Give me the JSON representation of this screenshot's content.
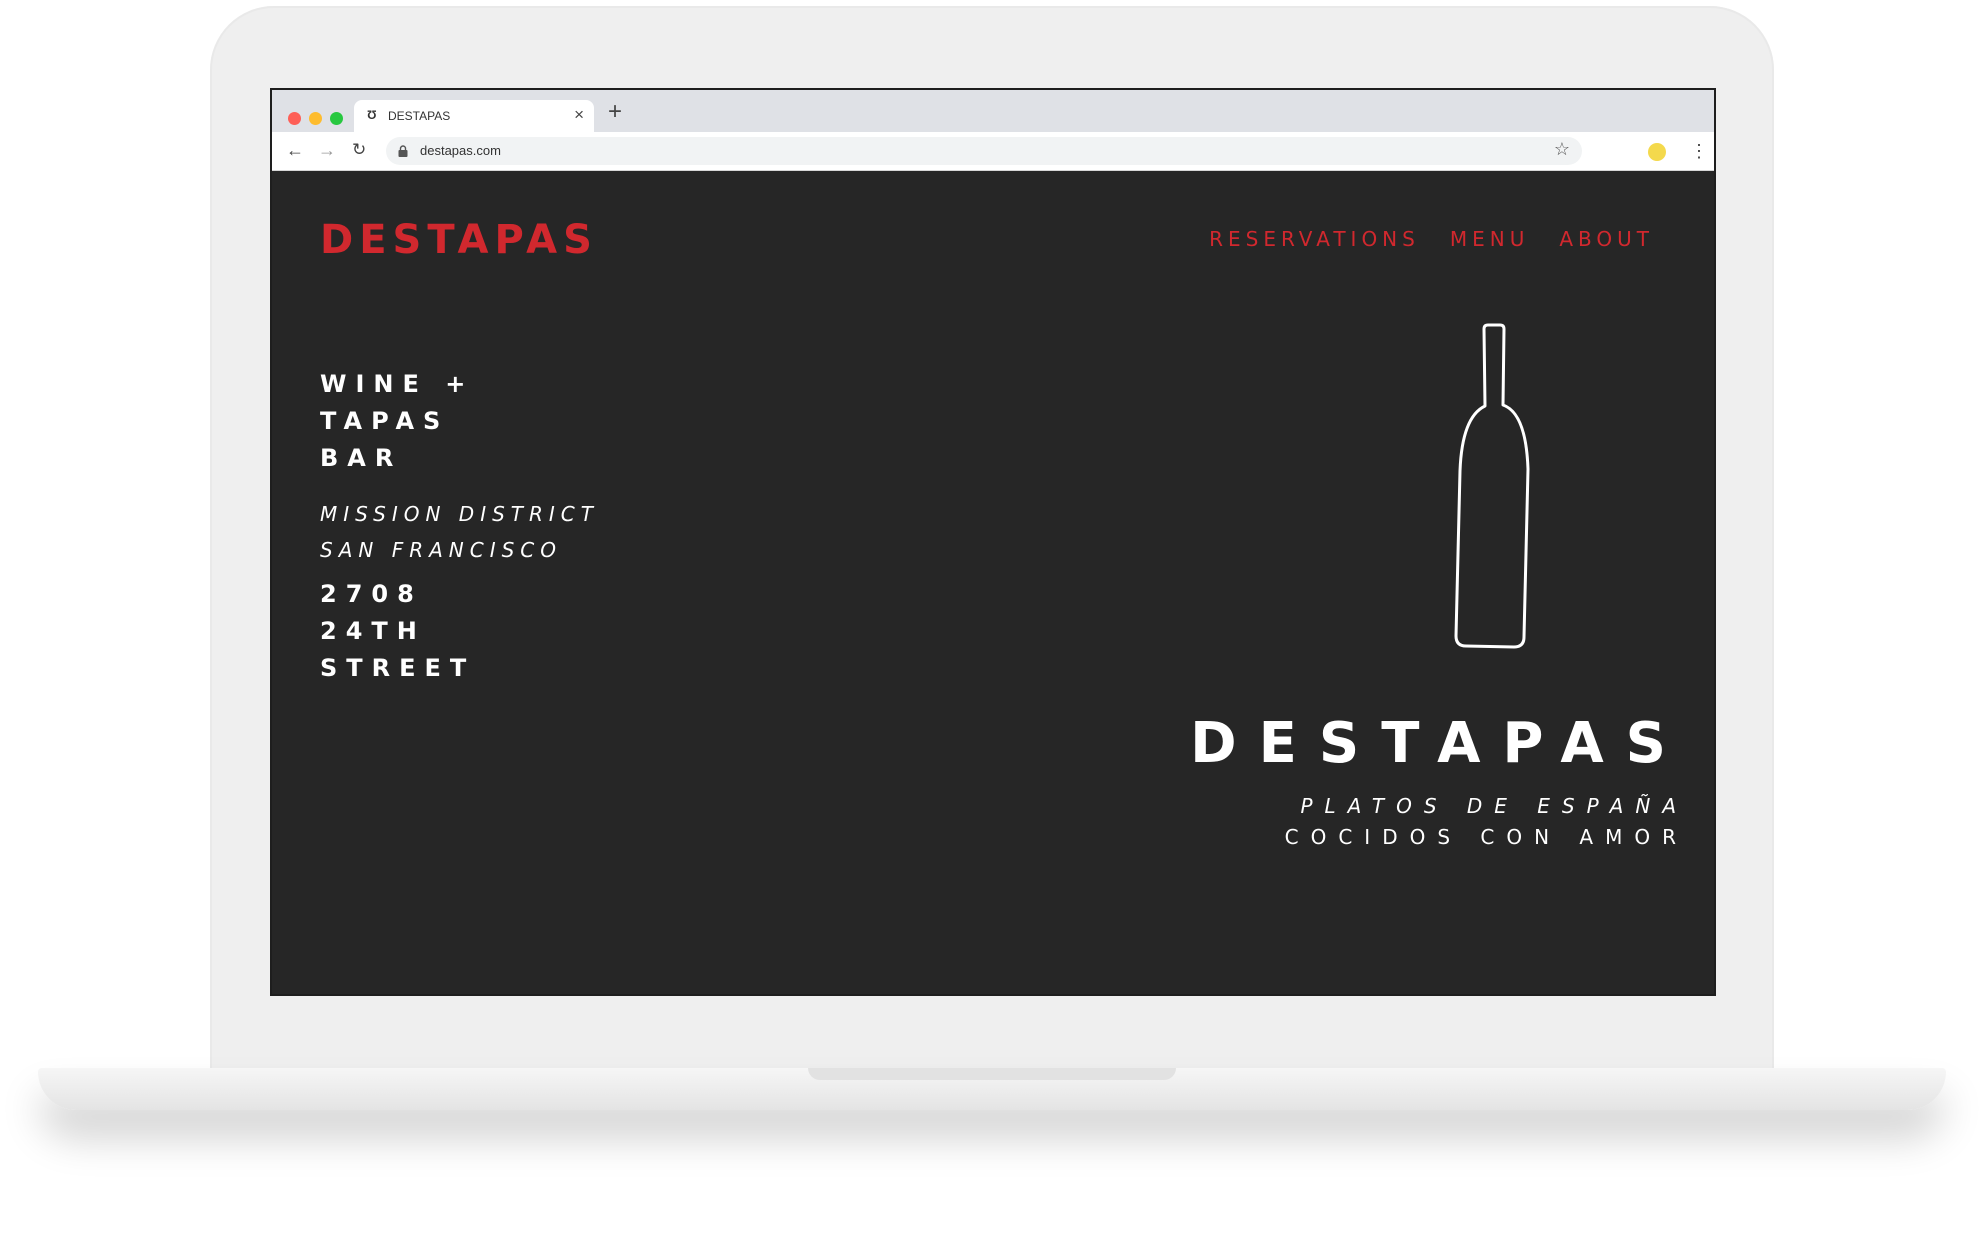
{
  "browser": {
    "tab_title": "DESTAPAS",
    "tab_icon_glyph": "Ʊ",
    "tab_close_glyph": "×",
    "new_tab_glyph": "+",
    "url": "destapas.com",
    "back_glyph": "←",
    "forward_glyph": "→",
    "reload_glyph": "↻",
    "star_glyph": "☆",
    "menu_glyph": "⋮",
    "profile_color": "#f4d94c"
  },
  "site": {
    "logo": "DESTAPAS",
    "nav": [
      "RESERVATIONS",
      "MENU",
      "ABOUT"
    ],
    "tagline_lines": [
      "WINE +",
      "TAPAS",
      "BAR"
    ],
    "location_lines": [
      "MISSION DISTRICT",
      "SAN FRANCISCO"
    ],
    "address_lines": [
      "2708",
      "24TH",
      "STREET"
    ],
    "hero_title": "DESTAPAS",
    "hero_sub_line1": "PLATOS DE ESPAÑA",
    "hero_sub_line2": "COCIDOS CON AMOR",
    "illustration": "wine-bottle-icon"
  },
  "colors": {
    "background": "#262626",
    "accent": "#d1282e",
    "text": "#ffffff"
  }
}
